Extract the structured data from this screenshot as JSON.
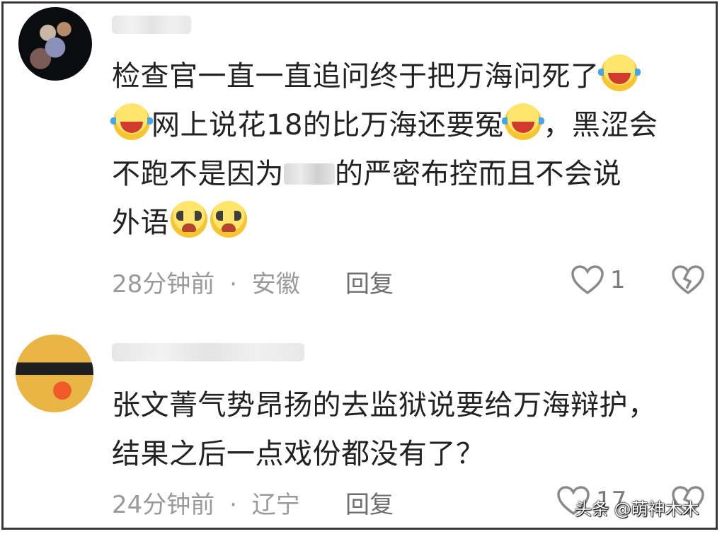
{
  "comments": [
    {
      "lines": [
        {
          "parts": [
            "检查官一直一直追问终于把万海问死了"
          ],
          "emojis": [
            "laughing-tears-icon"
          ]
        },
        {
          "text_a": "网上说花18的比万海还要冤",
          "text_b": "，黑涩会"
        },
        {
          "text_a": "不跑不是因为",
          "text_b": "的严密布控而且不会说"
        },
        {
          "text_a": "外语"
        }
      ],
      "time": "28分钟前",
      "separator": "·",
      "location": "安徽",
      "reply_label": "回复",
      "like_count": "1"
    },
    {
      "lines": [
        {
          "text_a": "张文菁气势昂扬的去监狱说要给万海辩护，"
        },
        {
          "text_a": "结果之后一点戏份都没有了？"
        }
      ],
      "time": "24分钟前",
      "separator": "·",
      "location": "辽宁",
      "reply_label": "回复",
      "like_count": "17"
    }
  ],
  "watermark": "头条 @萌神木木",
  "colors": {
    "text": "#222222",
    "meta": "#9a9a9a",
    "border": "#3a3a3a"
  }
}
